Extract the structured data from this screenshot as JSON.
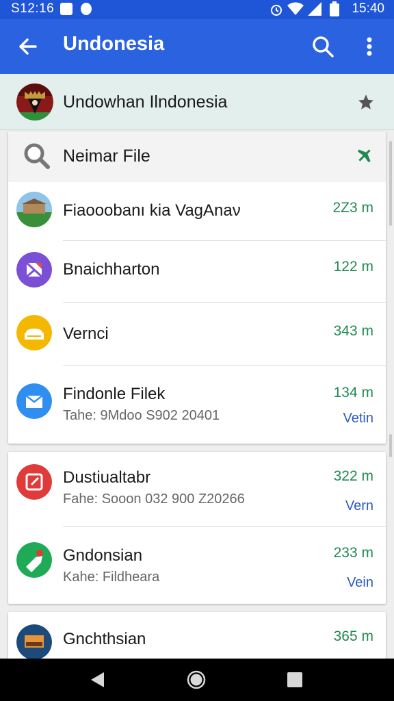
{
  "status_bar": {
    "time_left": "S12:16",
    "time_right": "15:40"
  },
  "app_bar": {
    "title": "Undonesia",
    "back_icon": "arrow-left-icon",
    "search_icon": "search-icon",
    "more_icon": "more-vert-icon"
  },
  "header": {
    "label": "Undowhan Ilndonesia",
    "star_icon": "star-icon"
  },
  "search_row": {
    "label": "Neimar File",
    "icon": "magnifier-icon",
    "pin_icon": "pin-icon"
  },
  "list_card1": [
    {
      "name": "Fiaooobanı kia  VagAnaν",
      "distance": "2Z3 m",
      "icon": "landmark-photo-icon"
    },
    {
      "name": "Bnaichharton",
      "distance": "122 m",
      "icon": "purple-app-icon"
    },
    {
      "name": "Vernci",
      "distance": "343 m",
      "icon": "yellow-app-icon"
    },
    {
      "name": "Findonle Filek",
      "sub": "Tahe: 9Mdoo S902 20401",
      "distance": "134 m",
      "view": "Vetin",
      "icon": "folder-blue-icon"
    }
  ],
  "list_card2": [
    {
      "name": "Dustiualtabr",
      "sub": "Fahe: Sooon 032 900 Z20266",
      "distance": "322 m",
      "view": "Vern",
      "icon": "red-app-icon"
    },
    {
      "name": "Gndonsian",
      "sub": "Kahe: Fildheara",
      "distance": "233 m",
      "view": "Vein",
      "icon": "green-map-icon"
    }
  ],
  "list_card3": [
    {
      "name": "Gnchthsian",
      "distance": "365 m",
      "icon": "navy-photo-icon"
    }
  ],
  "colors": {
    "app_bar": "#2a62e0",
    "distance": "#1f8a50",
    "view_link": "#2a5bc4"
  },
  "nav_bar": {
    "back_icon": "nav-back-icon",
    "home_icon": "nav-home-icon",
    "recents_icon": "nav-recents-icon"
  }
}
